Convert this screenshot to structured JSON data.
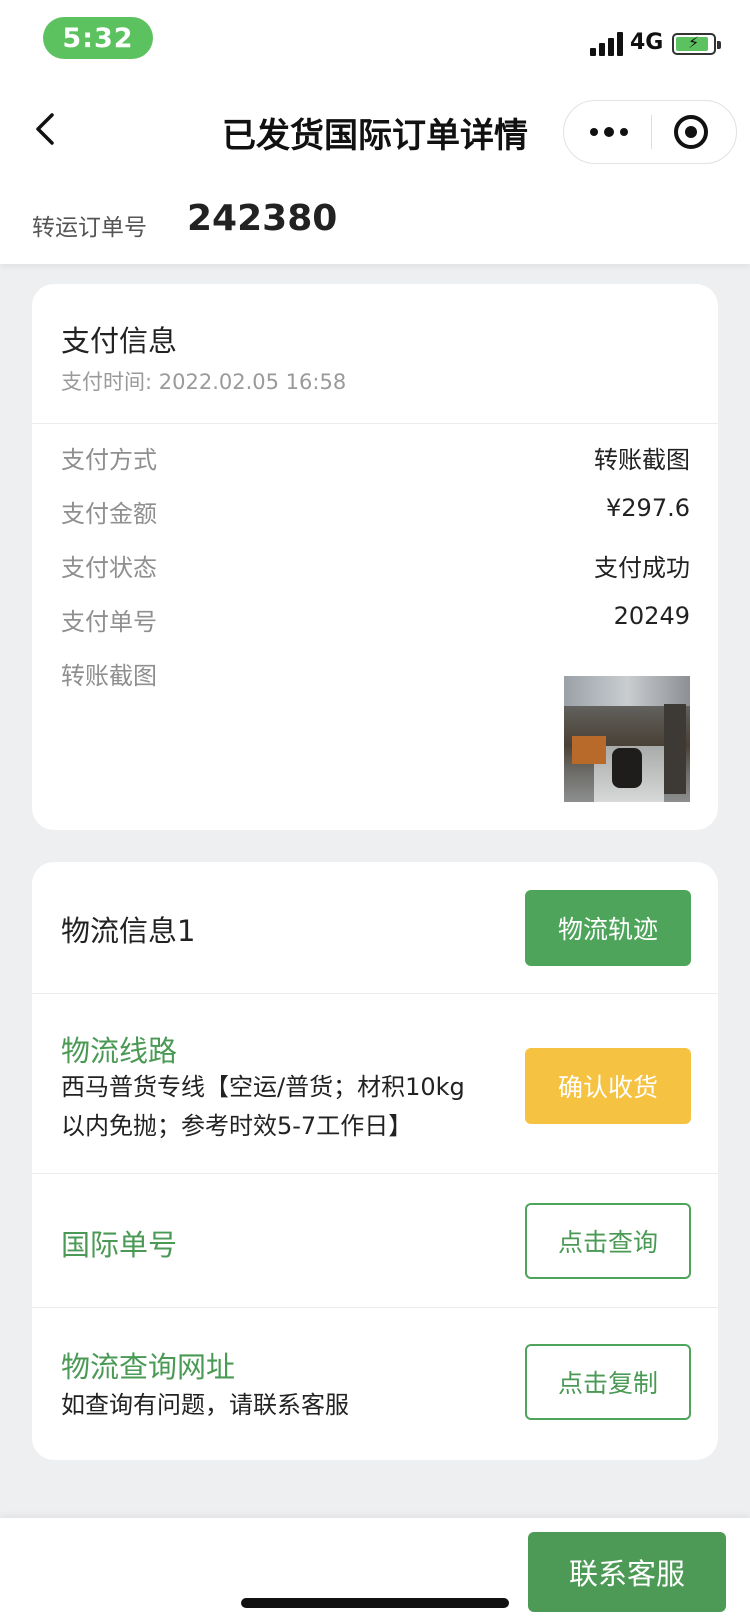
{
  "status_bar": {
    "time": "5:32",
    "network": "4G",
    "battery_color": "#5cc25f"
  },
  "nav": {
    "title": "已发货国际订单详情",
    "back_icon": "chevron-left-icon",
    "more_icon": "more-dots-icon",
    "close_icon": "target-circle-icon"
  },
  "order": {
    "label": "转运订单号",
    "number": "242380"
  },
  "payment": {
    "title": "支付信息",
    "time": "支付时间: 2022.02.05 16:58",
    "rows": [
      {
        "key": "支付方式",
        "value": "转账截图"
      },
      {
        "key": "支付金额",
        "value": "¥297.6"
      },
      {
        "key": "支付状态",
        "value": "支付成功"
      },
      {
        "key": "支付单号",
        "value": "20249"
      }
    ],
    "screenshot_label": "转账截图"
  },
  "logistics": {
    "title": "物流信息1",
    "track_button": "物流轨迹",
    "route_title": "物流线路",
    "route_line1": "西马普货专线【空运/普货；材积10kg",
    "route_line2": "以内免抛；参考时效5-7工作日】",
    "confirm_button": "确认收货",
    "intl_number_title": "国际单号",
    "query_button": "点击查询",
    "query_url_title": "物流查询网址",
    "query_url_note": "如查询有问题，请联系客服",
    "copy_button": "点击复制"
  },
  "bottom": {
    "contact_button": "联系客服"
  },
  "colors": {
    "accent_green": "#4ea45a",
    "confirm_yellow": "#f5c242"
  }
}
